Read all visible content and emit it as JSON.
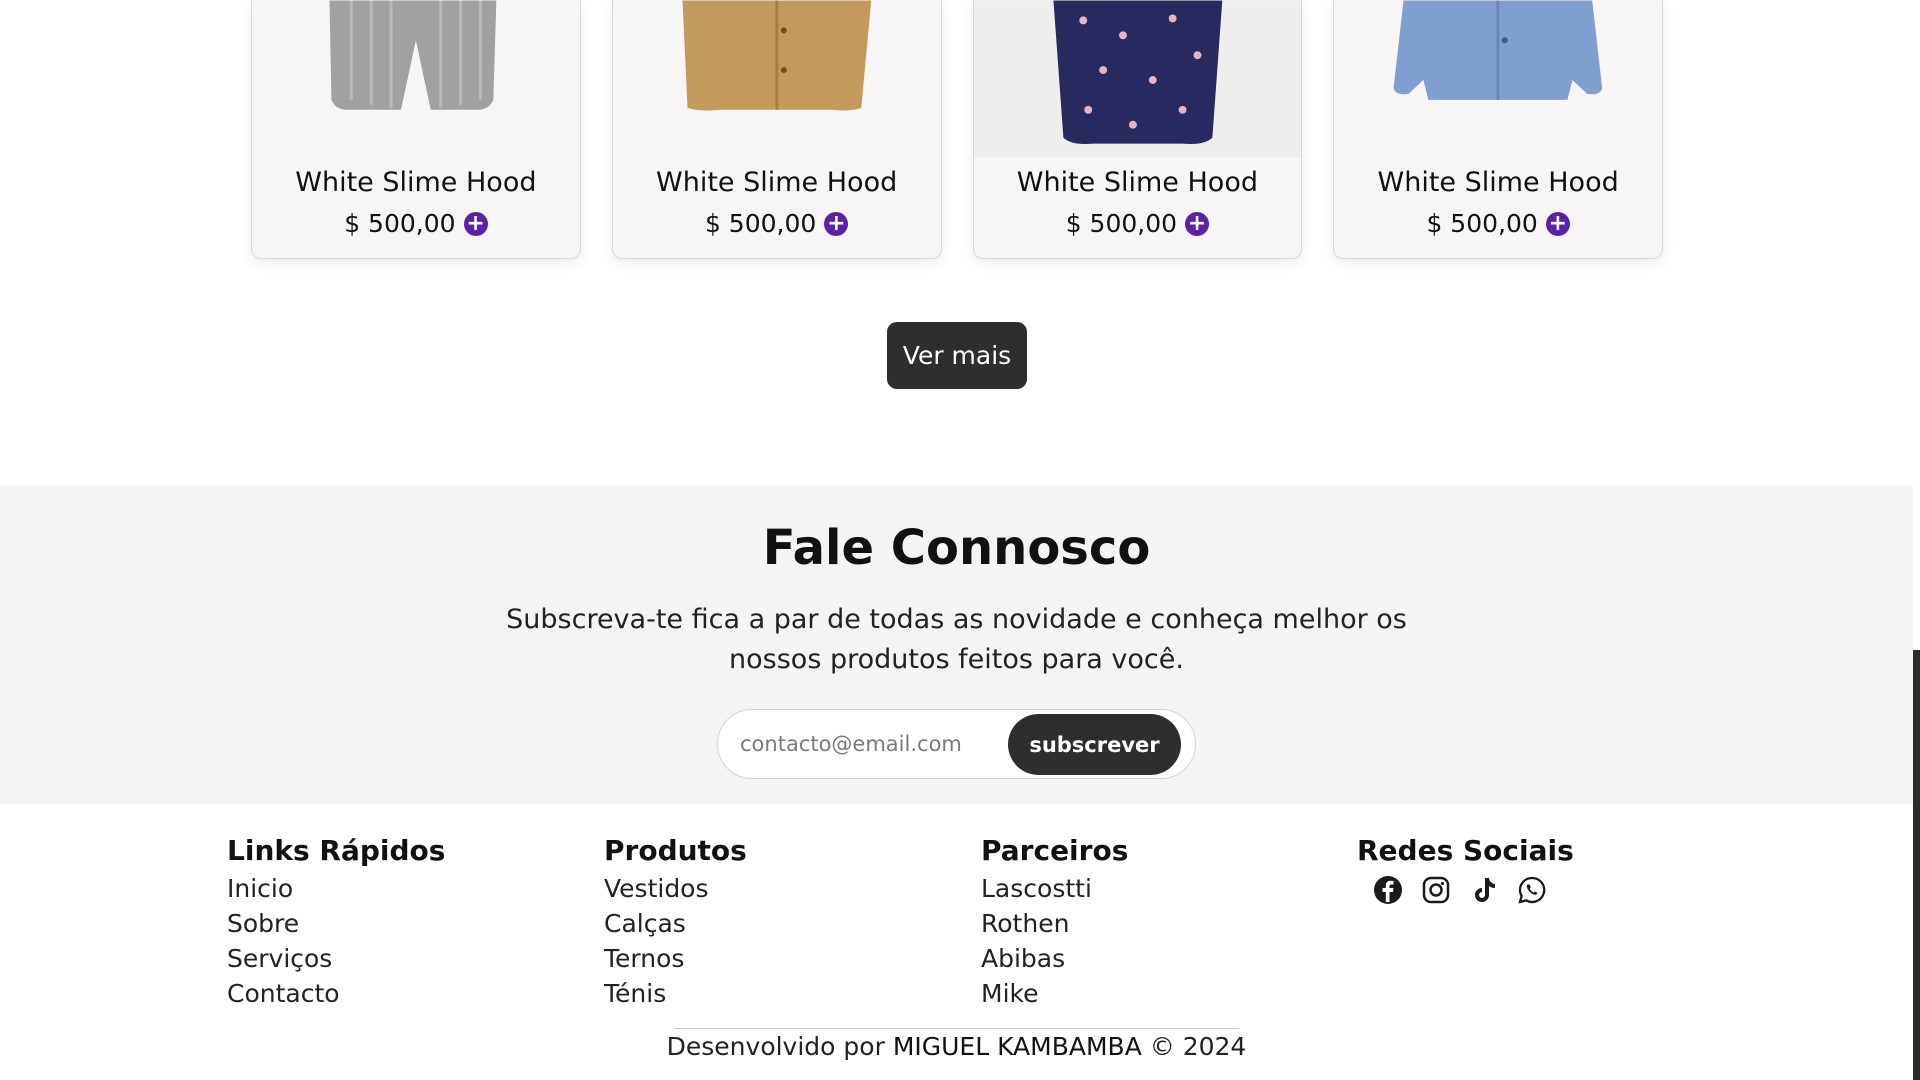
{
  "products": [
    {
      "name": "White Slime Hood",
      "price": "$ 500,00",
      "image": "grey-shorts"
    },
    {
      "name": "White Slime Hood",
      "price": "$ 500,00",
      "image": "tan-shirt"
    },
    {
      "name": "White Slime Hood",
      "price": "$ 500,00",
      "image": "navy-floral-shirt"
    },
    {
      "name": "White Slime Hood",
      "price": "$ 500,00",
      "image": "blue-denim-shirt"
    }
  ],
  "actions": {
    "ver_mais": "Ver mais",
    "add_icon": "+"
  },
  "contact": {
    "title": "Fale Connosco",
    "description": "Subscreva-te fica a par de todas as novidade e conheça melhor os nossos produtos feitos para você.",
    "email_placeholder": "contacto@email.com",
    "subscribe_label": "subscrever"
  },
  "footer": {
    "quick_links": {
      "title": "Links Rápidos",
      "items": [
        "Inicio",
        "Sobre",
        "Serviços",
        "Contacto"
      ]
    },
    "products": {
      "title": "Produtos",
      "items": [
        "Vestidos",
        "Calças",
        "Ternos",
        "Ténis"
      ]
    },
    "partners": {
      "title": "Parceiros",
      "items": [
        "Lascostti",
        "Rothen",
        "Abibas",
        "Mike"
      ]
    },
    "socials": {
      "title": "Redes Sociais",
      "icons": [
        "facebook-icon",
        "instagram-icon",
        "tiktok-icon",
        "whatsapp-icon"
      ]
    },
    "credits_prefix": "Desenvolvido por",
    "developer": "MIGUEL KAMBAMBA",
    "credits_suffix": "© 2024"
  },
  "colors": {
    "accent": "#5b21a6",
    "dark": "#2e2e2e",
    "section_bg": "#f6f3f4"
  }
}
